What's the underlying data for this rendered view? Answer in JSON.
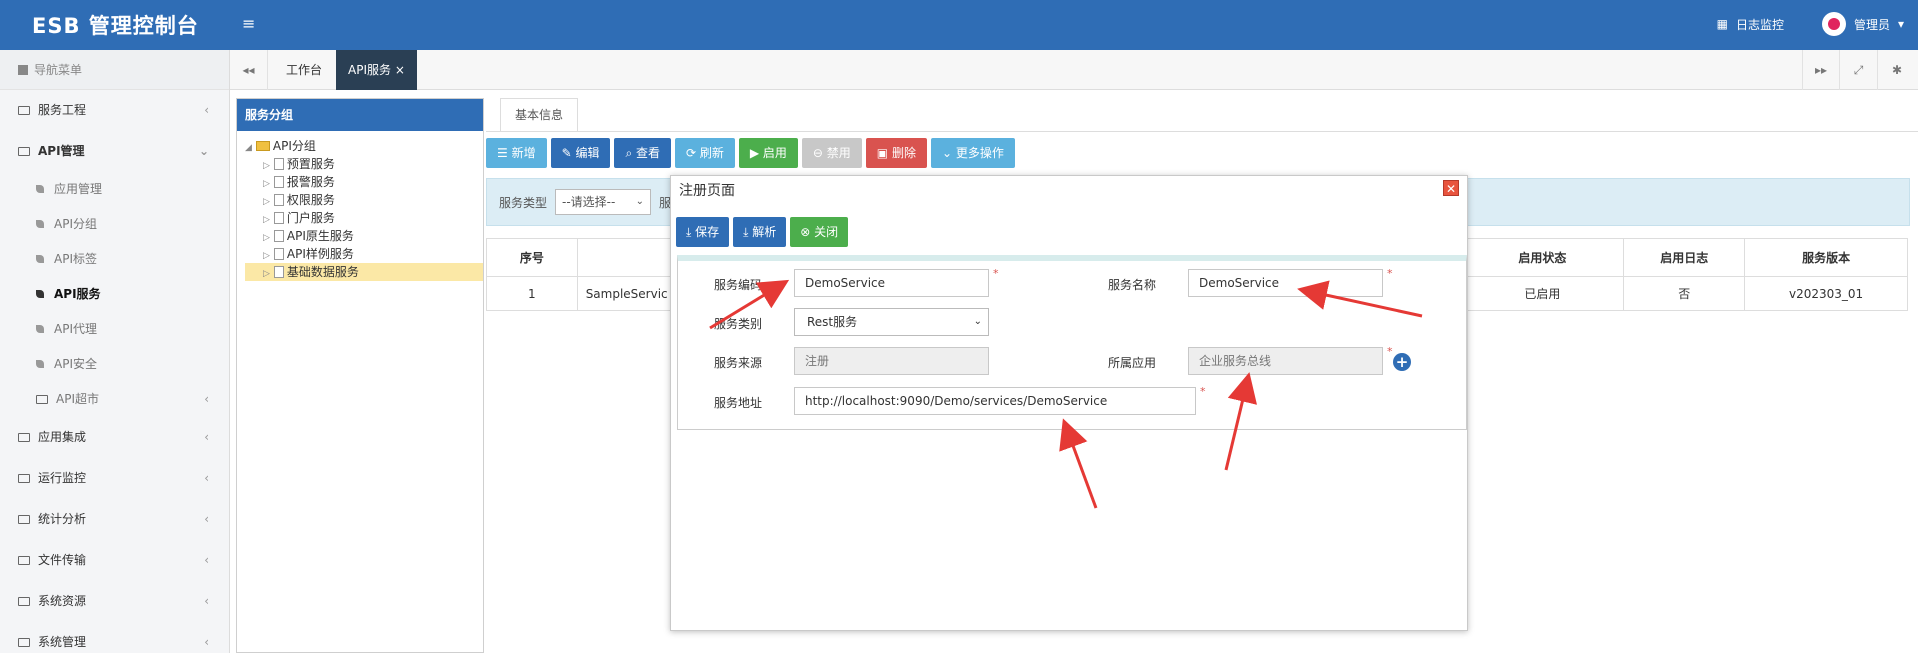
{
  "header": {
    "brand": "ESB 管理控制台",
    "menu_toggle": "≡",
    "log_monitor": "日志监控",
    "user": "管理员",
    "user_caret": "▾"
  },
  "sidebar": {
    "nav_title": "导航菜单",
    "items": [
      {
        "label": "服务工程"
      },
      {
        "label": "API管理"
      },
      {
        "label": "应用集成"
      },
      {
        "label": "运行监控"
      },
      {
        "label": "统计分析"
      },
      {
        "label": "文件传输"
      },
      {
        "label": "系统资源"
      },
      {
        "label": "系统管理"
      }
    ],
    "sub_items": [
      {
        "label": "应用管理"
      },
      {
        "label": "API分组"
      },
      {
        "label": "API标签"
      },
      {
        "label": "API服务"
      },
      {
        "label": "API代理"
      },
      {
        "label": "API安全"
      },
      {
        "label": "API超市"
      }
    ]
  },
  "tabs": {
    "workbench": "工作台",
    "api_service": "API服务",
    "close_glyph": "×",
    "prev_glyph": "◂◂",
    "next_glyph": "▸▸",
    "fullscreen_glyph": "⤢",
    "settings_glyph": "✱"
  },
  "tree": {
    "title": "服务分组",
    "root": "API分组",
    "children": [
      "预置服务",
      "报警服务",
      "权限服务",
      "门户服务",
      "API原生服务",
      "API样例服务",
      "基础数据服务"
    ]
  },
  "main": {
    "basic_tab": "基本信息",
    "toolbar": {
      "new": "☰ 新增",
      "edit": "✎ 编辑",
      "view": "⌕ 查看",
      "refresh": "⟳ 刷新",
      "enable": "▶ 启用",
      "disable": "⊖ 禁用",
      "delete": "▣ 删除",
      "more": "⌄ 更多操作"
    },
    "filter": {
      "service_type_label": "服务类型",
      "select_placeholder": "--请选择--",
      "next_label_partial": "服"
    },
    "table": {
      "headers": [
        "序号",
        "",
        "启用状态",
        "启用日志",
        "服务版本"
      ],
      "rows": [
        [
          "1",
          "SampleServic",
          "已启用",
          "否",
          "v202303_01"
        ]
      ]
    }
  },
  "modal": {
    "title": "注册页面",
    "close_glyph": "✕",
    "buttons": {
      "save": "⤓ 保存",
      "parse": "⤓ 解析",
      "close": "⊗ 关闭"
    },
    "form": {
      "service_code_label": "服务编码",
      "service_code_value": "DemoService",
      "service_name_label": "服务名称",
      "service_name_value": "DemoService",
      "service_category_label": "服务类别",
      "service_category_value": "Rest服务",
      "service_source_label": "服务来源",
      "service_source_value": "注册",
      "owning_app_label": "所属应用",
      "owning_app_value": "企业服务总线",
      "service_address_label": "服务地址",
      "service_address_value": "http://localhost:9090/Demo/services/DemoService",
      "required_mark": "*",
      "add_glyph": "+"
    }
  },
  "colors": {
    "header_blue": "#2f6db5",
    "active_tab": "#2a3f54",
    "annotation_arrow": "#e53935"
  }
}
